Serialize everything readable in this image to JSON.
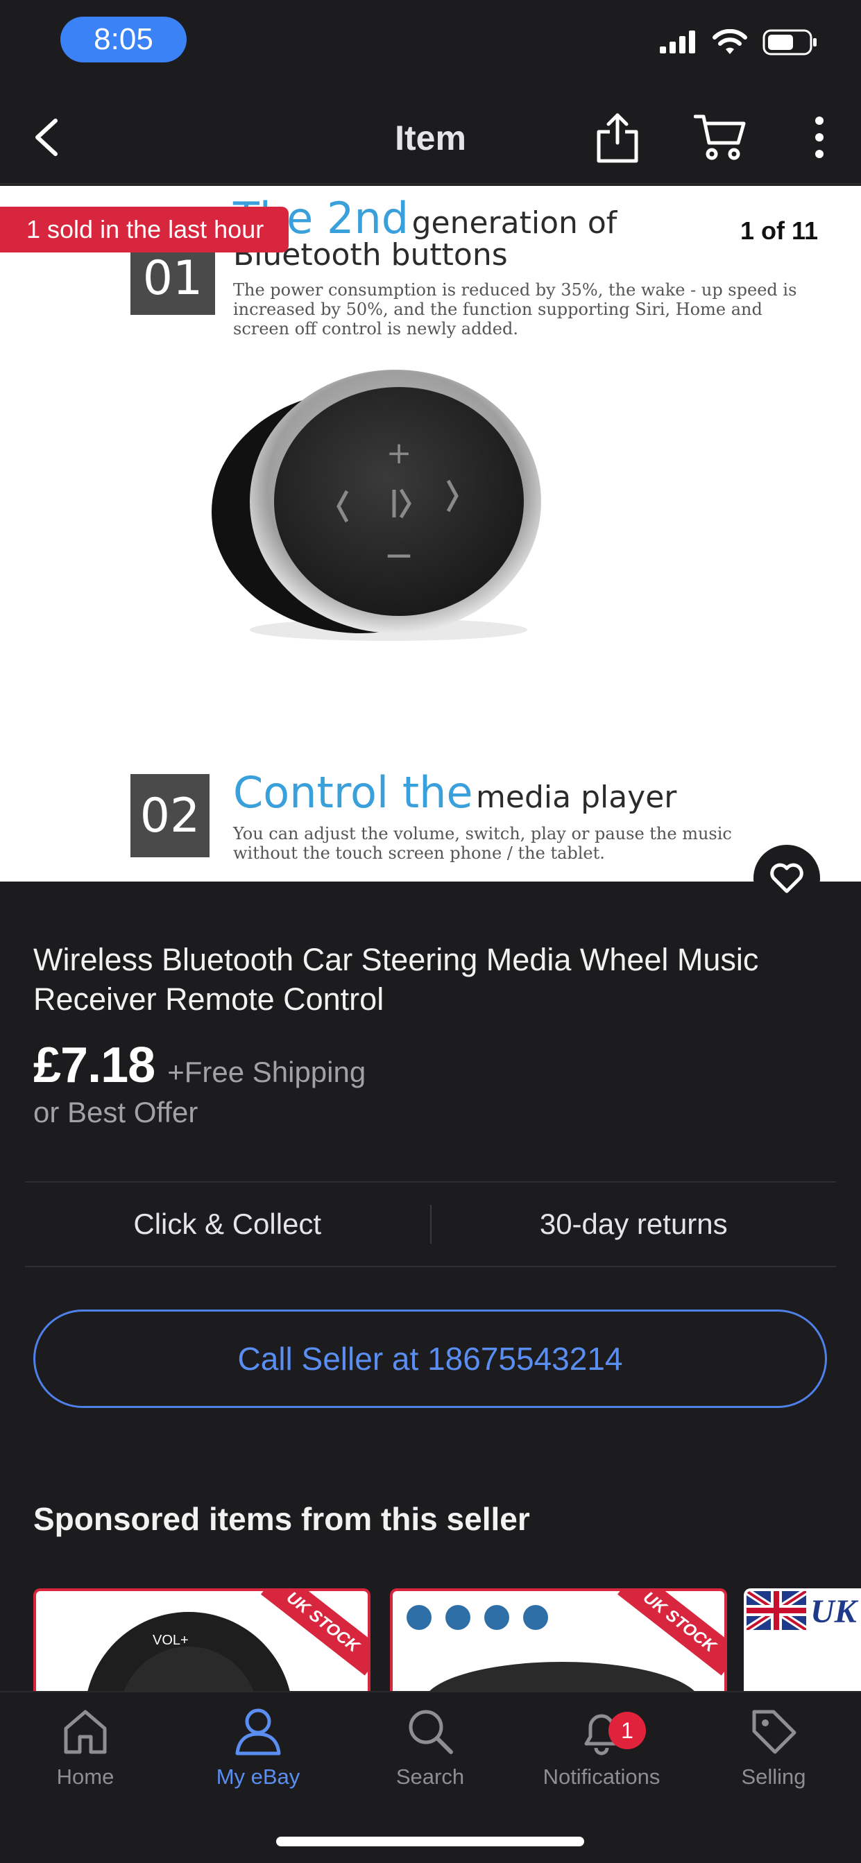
{
  "status": {
    "time": "8:05"
  },
  "nav": {
    "title": "Item"
  },
  "hero": {
    "sold_badge": "1 sold in the last hour",
    "counter": "1 of 11",
    "feature1": {
      "number": "01",
      "heading_blue": "The 2nd",
      "heading_dark": "generation of",
      "heading_line2": "Bluetooth buttons",
      "desc_line1": "The power consumption is reduced by 35%, the wake - up speed is",
      "desc_line2": "increased by 50%, and the function supporting Siri, Home and",
      "desc_line3": "screen off control is newly added."
    },
    "feature2": {
      "number": "02",
      "heading_blue": "Control the",
      "heading_dark": "media player",
      "desc_line1": "You can adjust the volume, switch, play or pause the music",
      "desc_line2": "without the touch screen phone / the tablet."
    }
  },
  "product": {
    "title": "Wireless Bluetooth Car Steering Media Wheel Music Receiver Remote Control",
    "price": "£7.18",
    "shipping": "+Free Shipping",
    "best_offer": "or Best Offer"
  },
  "info": {
    "collect": "Click & Collect",
    "returns": "30-day returns"
  },
  "call_button": "Call Seller at 18675543214",
  "sponsored": {
    "title": "Sponsored items from this seller",
    "card1": {
      "ribbon": "UK STOCK",
      "text": "VOL+"
    },
    "card2": {
      "ribbon": "UK STOCK"
    },
    "card3": {
      "text": "UK"
    }
  },
  "tabs": [
    {
      "label": "Home",
      "icon": "home-icon"
    },
    {
      "label": "My eBay",
      "icon": "user-icon"
    },
    {
      "label": "Search",
      "icon": "search-icon"
    },
    {
      "label": "Notifications",
      "icon": "bell-icon",
      "badge": "1"
    },
    {
      "label": "Selling",
      "icon": "tag-icon"
    }
  ],
  "colors": {
    "accent": "#5b8ef2",
    "badge": "#d7263d",
    "background": "#1c1c1e"
  }
}
